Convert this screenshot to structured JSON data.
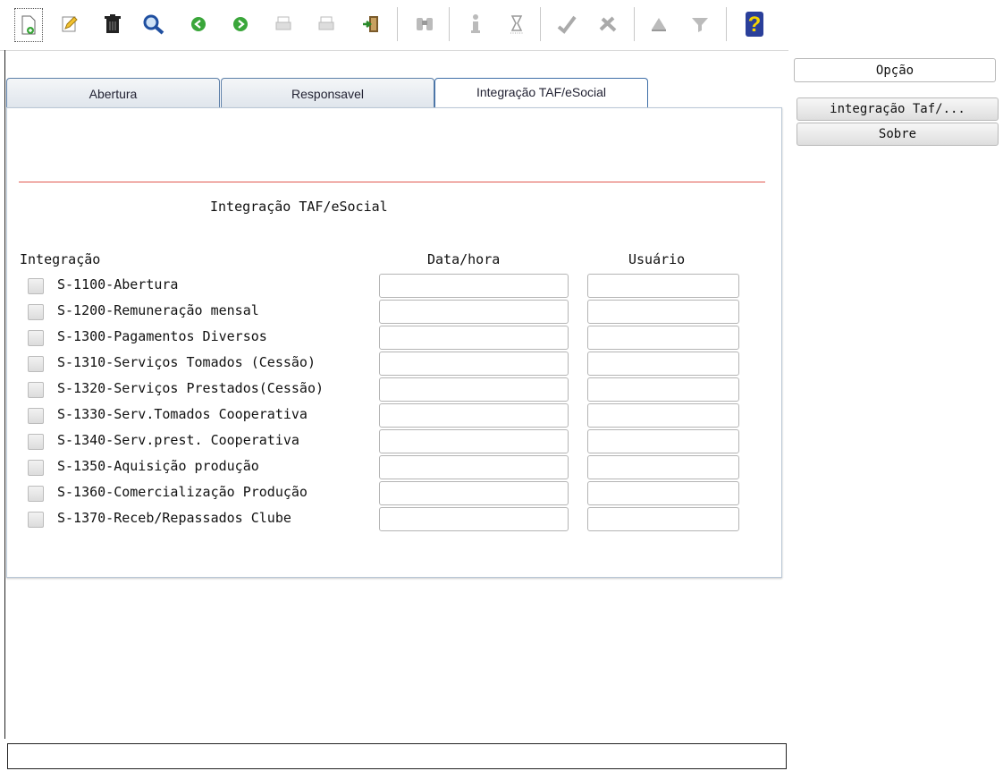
{
  "toolbar": {
    "icons": [
      "new-document-icon",
      "edit-icon",
      "delete-icon",
      "search-icon",
      "previous-icon",
      "next-icon",
      "print-icon",
      "print-preview-icon",
      "exit-icon",
      "binoculars-icon",
      "info-icon",
      "hourglass-icon",
      "confirm-icon",
      "cancel-icon",
      "up-icon",
      "filter-icon",
      "help-icon"
    ]
  },
  "tabs": [
    {
      "label": "Abertura"
    },
    {
      "label": "Responsavel"
    },
    {
      "label": "Integração TAF/eSocial"
    }
  ],
  "section": {
    "title": "Integração TAF/eSocial",
    "col_integracao": "Integração",
    "col_datahora": "Data/hora",
    "col_usuario": "Usuário"
  },
  "rows": [
    {
      "label": "S-1100-Abertura",
      "datahora": "",
      "usuario": ""
    },
    {
      "label": "S-1200-Remuneração mensal",
      "datahora": "",
      "usuario": ""
    },
    {
      "label": "S-1300-Pagamentos Diversos",
      "datahora": "",
      "usuario": ""
    },
    {
      "label": "S-1310-Serviços Tomados (Cessão)",
      "datahora": "",
      "usuario": ""
    },
    {
      "label": "S-1320-Serviços Prestados(Cessão)",
      "datahora": "",
      "usuario": ""
    },
    {
      "label": "S-1330-Serv.Tomados Cooperativa",
      "datahora": "",
      "usuario": ""
    },
    {
      "label": "S-1340-Serv.prest. Cooperativa",
      "datahora": "",
      "usuario": ""
    },
    {
      "label": "S-1350-Aquisição produção",
      "datahora": "",
      "usuario": ""
    },
    {
      "label": "S-1360-Comercialização Produção",
      "datahora": "",
      "usuario": ""
    },
    {
      "label": "S-1370-Receb/Repassados Clube",
      "datahora": "",
      "usuario": ""
    }
  ],
  "side": {
    "opcao": "Opção",
    "buttons": [
      {
        "label": "integração Taf/..."
      },
      {
        "label": "Sobre"
      }
    ]
  },
  "status_bar": {
    "text": ""
  },
  "colors": {
    "accent_line": "#e0584e",
    "tab_border": "#3f6fa8"
  }
}
